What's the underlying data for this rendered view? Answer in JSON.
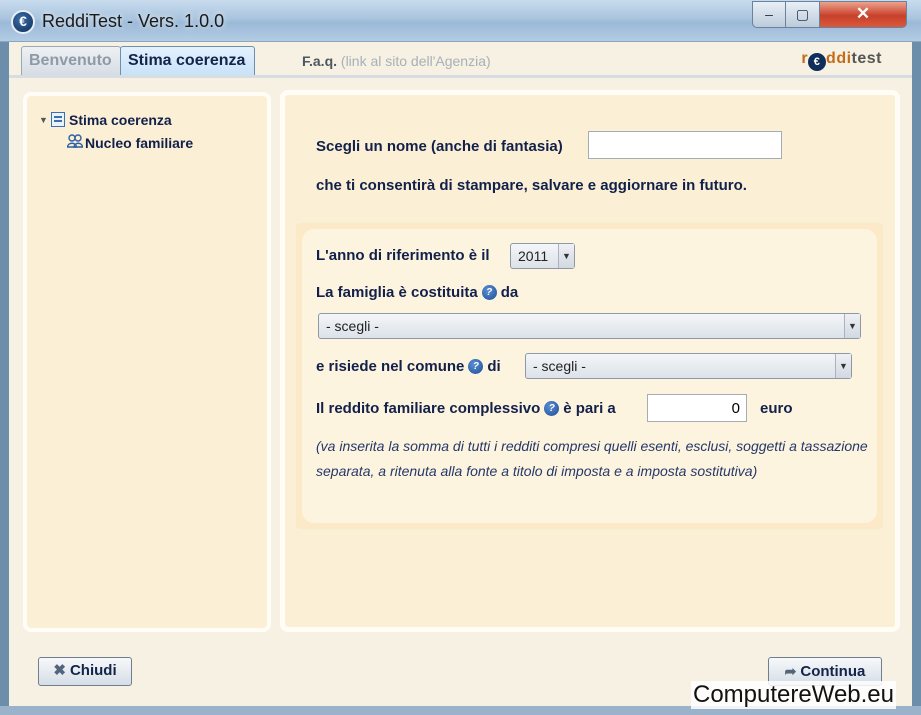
{
  "window": {
    "icon_glyph": "€",
    "title": "ReddiTest - Vers. 1.0.0",
    "minimize": "–",
    "maximize": "▢",
    "close": "✕"
  },
  "tabs": [
    {
      "label": "Benvenuto",
      "active": false
    },
    {
      "label": "Stima coerenza",
      "active": true
    }
  ],
  "faq": {
    "title": "F.a.q.",
    "link": "(link al sito dell'Agenzia)"
  },
  "logo": {
    "r": "r",
    "e": "€",
    "dd": "ddi",
    "rest": "test"
  },
  "tree": {
    "expand_glyph": "▼",
    "root": "Stima coerenza",
    "child": "Nucleo familiare"
  },
  "form": {
    "name_label": "Scegli un nome (anche di fantasia)",
    "name_value": "",
    "name_hint": "che ti consentirà di stampare, salvare e aggiornare in futuro.",
    "year_label": "L'anno di riferimento è il",
    "year_value": "2011",
    "family_label_a": "La famiglia è costituita",
    "family_label_b": "da",
    "family_value": "- scegli -",
    "comune_label_a": "e risiede nel comune",
    "comune_label_b": "di",
    "comune_value": "- scegli -",
    "income_label_a": "Il reddito familiare complessivo",
    "income_label_b": "è pari a",
    "income_value": "0",
    "income_unit": "euro",
    "note": "(va inserita la somma di tutti i redditi compresi quelli esenti, esclusi, soggetti a tassazione separata, a ritenuta alla fonte a titolo di imposta e a imposta sostitutiva)",
    "help_glyph": "?",
    "arrow_glyph": "▼"
  },
  "buttons": {
    "close_glyph": "✖",
    "close": "Chiudi",
    "next_glyph": "➦",
    "next": "Continua"
  },
  "watermark": "ComputereWeb.eu"
}
